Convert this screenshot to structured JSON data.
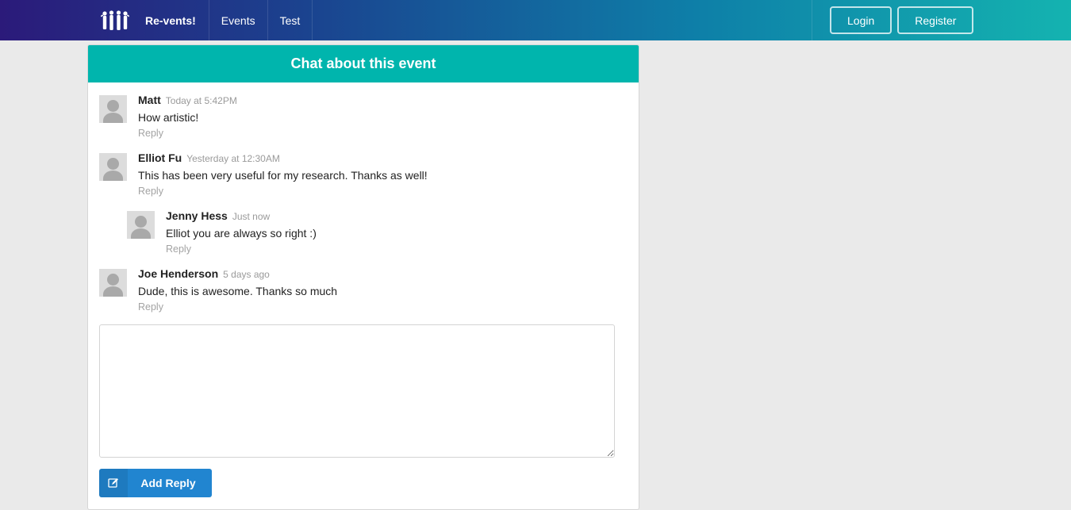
{
  "navbar": {
    "brand_label": "Re-vents!",
    "brand_icon": "people-group-icon",
    "items": [
      {
        "label": "Events"
      },
      {
        "label": "Test"
      }
    ],
    "login_label": "Login",
    "register_label": "Register"
  },
  "chat": {
    "header_title": "Chat about this event",
    "comments": [
      {
        "author": "Matt",
        "time": "Today at 5:42PM",
        "text": "How artistic!",
        "reply_label": "Reply",
        "nested": false
      },
      {
        "author": "Elliot Fu",
        "time": "Yesterday at 12:30AM",
        "text": "This has been very useful for my research. Thanks as well!",
        "reply_label": "Reply",
        "nested": false
      },
      {
        "author": "Jenny Hess",
        "time": "Just now",
        "text": "Elliot you are always so right :)",
        "reply_label": "Reply",
        "nested": true
      },
      {
        "author": "Joe Henderson",
        "time": "5 days ago",
        "text": "Dude, this is awesome. Thanks so much",
        "reply_label": "Reply",
        "nested": false
      }
    ],
    "reply_textarea_value": "",
    "add_reply_label": "Add Reply",
    "add_reply_icon": "edit-icon"
  },
  "colors": {
    "header_teal": "#00b5ad",
    "button_blue": "#2185d0",
    "nav_gradient_start": "#2b1a7a",
    "nav_gradient_end": "#14b3b0"
  }
}
